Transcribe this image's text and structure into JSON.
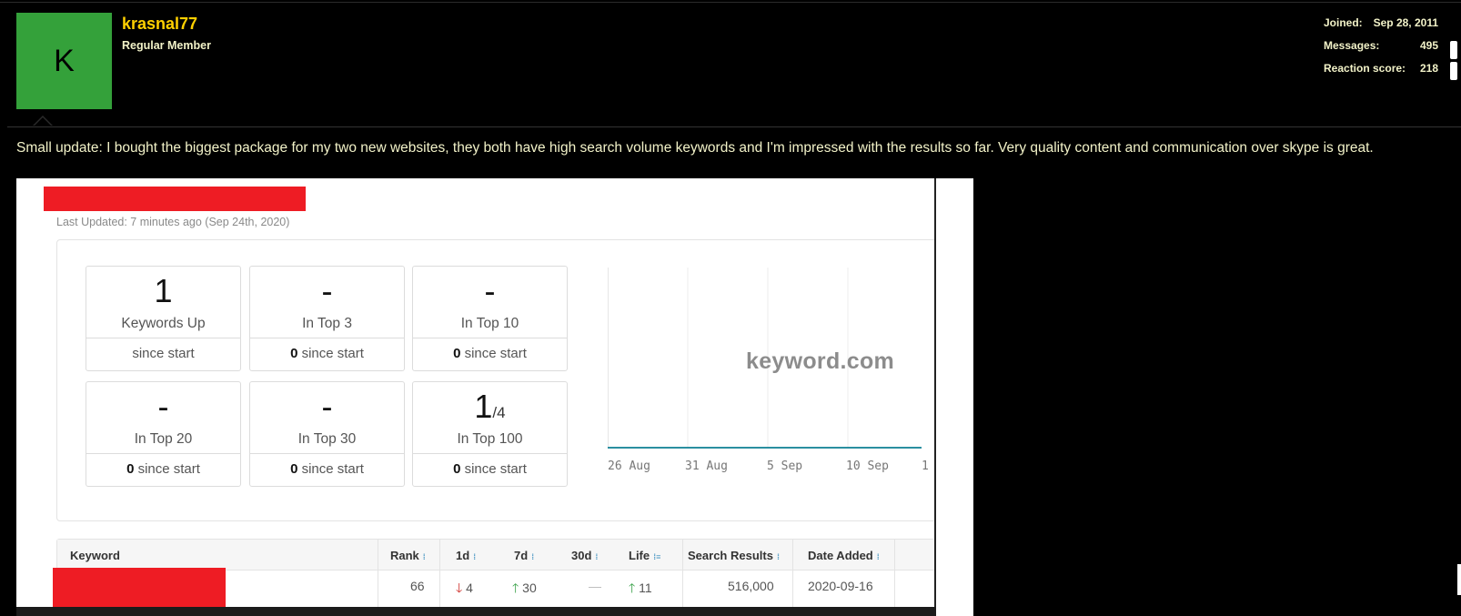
{
  "user": {
    "avatar_letter": "K",
    "name": "krasnal77",
    "title": "Regular Member",
    "stats": [
      {
        "label": "Joined:",
        "value": "Sep 28, 2011"
      },
      {
        "label": "Messages:",
        "value": "495"
      },
      {
        "label": "Reaction score:",
        "value": "218"
      }
    ]
  },
  "post": {
    "text": "Small update: I bought the biggest package for my two new websites, they both have high search volume keywords and I'm impressed with the results so far. Very quality content and communication over skype is great."
  },
  "screenshot": {
    "last_updated": "Last Updated: 7 minutes ago (Sep 24th, 2020)",
    "cards": [
      {
        "value": "1",
        "value_sub": "",
        "label": "Keywords Up",
        "foot_bold": "",
        "foot": "since start"
      },
      {
        "value": "-",
        "value_sub": "",
        "label": "In Top 3",
        "foot_bold": "0",
        "foot": " since start"
      },
      {
        "value": "-",
        "value_sub": "",
        "label": "In Top 10",
        "foot_bold": "0",
        "foot": " since start"
      },
      {
        "value": "-",
        "value_sub": "",
        "label": "In Top 20",
        "foot_bold": "0",
        "foot": " since start"
      },
      {
        "value": "-",
        "value_sub": "",
        "label": "In Top 30",
        "foot_bold": "0",
        "foot": " since start"
      },
      {
        "value": "1",
        "value_sub": "/4",
        "label": "In Top 100",
        "foot_bold": "0",
        "foot": " since start"
      }
    ],
    "watermark": "keyword.com",
    "table": {
      "headers": [
        "Keyword",
        "Rank",
        "1d",
        "7d",
        "30d",
        "Life",
        "Search Results",
        "Date Added"
      ],
      "row": {
        "rank": "66",
        "d1_arrow": "🡓",
        "d1": "4",
        "d7_arrow": "🡑",
        "d7": "30",
        "d30": "—",
        "life_arrow": "🡑",
        "life": "11",
        "search_results": "516,000",
        "date_added": "2020-09-16"
      }
    }
  },
  "chart_data": {
    "type": "line",
    "x": [
      "26 Aug",
      "31 Aug",
      "5 Sep",
      "10 Sep",
      "1"
    ],
    "series": [
      {
        "values": [
          0,
          0,
          0,
          0,
          0
        ]
      }
    ],
    "grid": true,
    "line_color": "#2a8fa0"
  }
}
